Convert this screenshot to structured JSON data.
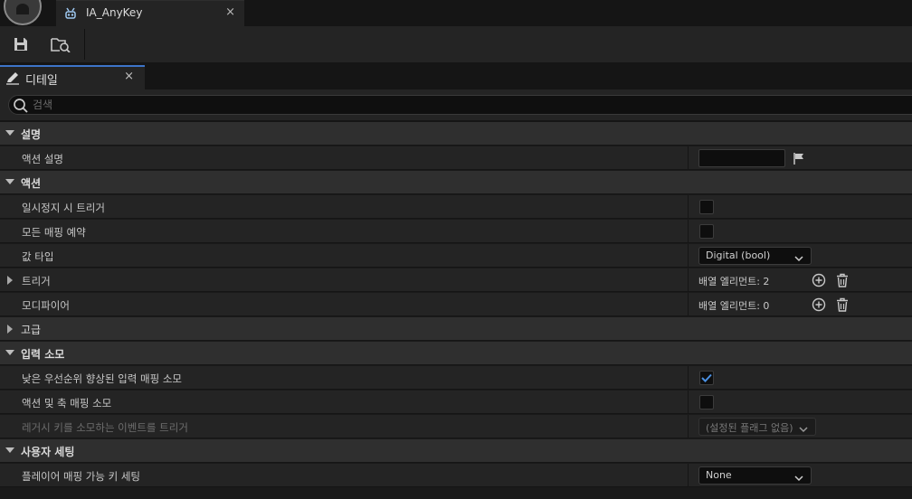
{
  "tab": {
    "title": "IA_AnyKey",
    "close": "×"
  },
  "panel": {
    "title": "디테일",
    "close": "×"
  },
  "search": {
    "placeholder": "검색"
  },
  "categories": {
    "description": "설명",
    "action": "액션",
    "advanced": "고급",
    "input_consumption": "입력 소모",
    "user_settings": "사용자 세팅"
  },
  "props": {
    "action_description": {
      "label": "액션 설명",
      "value": ""
    },
    "trigger_when_paused": {
      "label": "일시정지 시 트리거",
      "checked": false
    },
    "reserve_all_mappings": {
      "label": "모든 매핑 예약",
      "checked": false
    },
    "value_type": {
      "label": "값 타입",
      "value": "Digital (bool)"
    },
    "triggers": {
      "label": "트리거",
      "value": "배열 엘리먼트: 2"
    },
    "modifiers": {
      "label": "모디파이어",
      "value": "배열 엘리먼트: 0"
    },
    "consume_lower_priority": {
      "label": "낮은 우선순위 향상된 입력 매핑 소모",
      "checked": true
    },
    "consume_action_axis": {
      "label": "액션 및 축 매핑 소모",
      "checked": false
    },
    "trigger_legacy_events": {
      "label": "레거시 키를 소모하는 이벤트를 트리거",
      "value": "(설정된 플래그 없음)"
    },
    "player_mappable_settings": {
      "label": "플레이어 매핑 가능 키 세팅",
      "value": "None"
    }
  },
  "colors": {
    "accent": "#3d74c9",
    "check": "#4a90e2"
  }
}
